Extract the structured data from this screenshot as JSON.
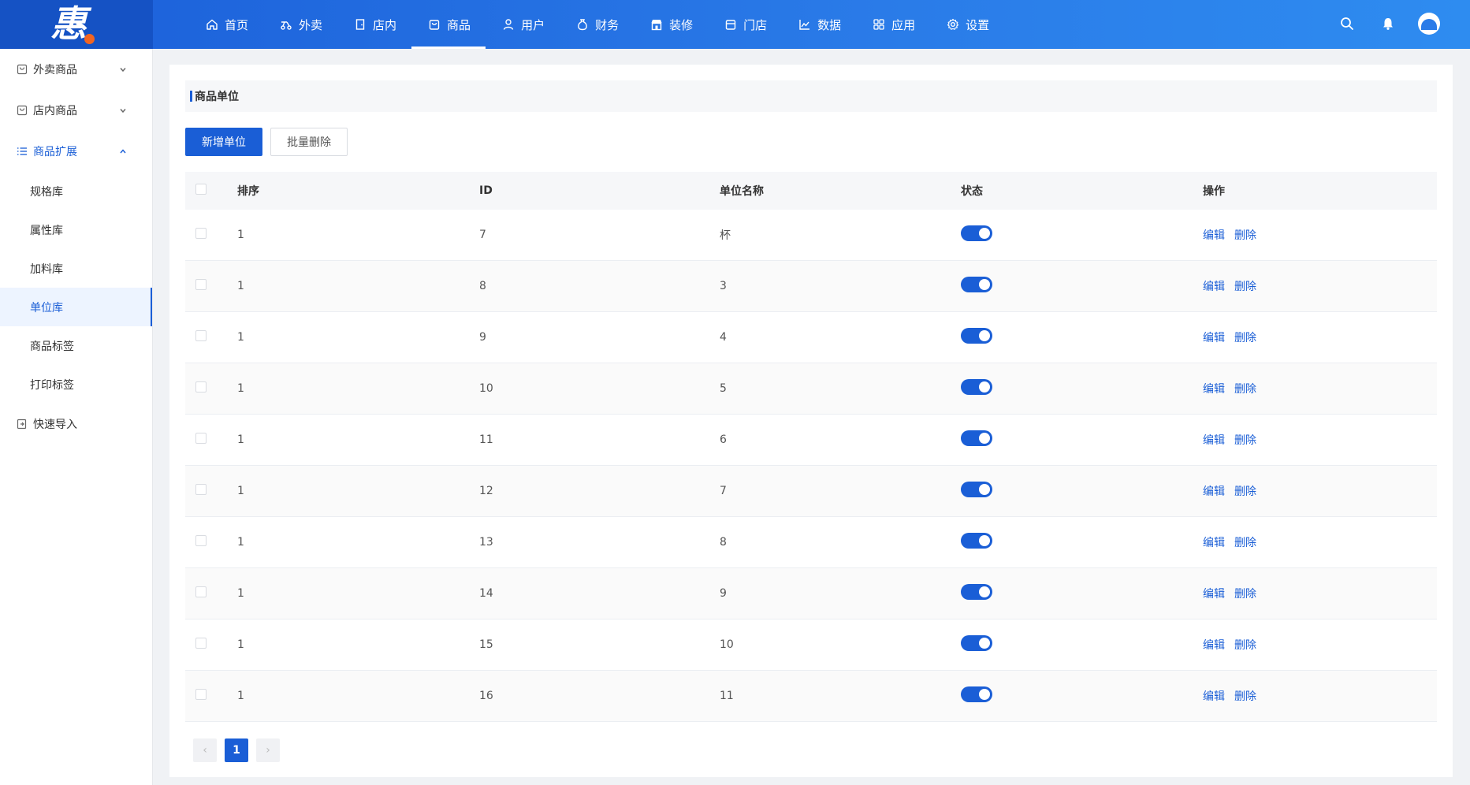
{
  "logo": {
    "glyph": "惠"
  },
  "nav": [
    {
      "label": "首页",
      "icon": "home-icon"
    },
    {
      "label": "外卖",
      "icon": "scooter-icon"
    },
    {
      "label": "店内",
      "icon": "door-icon"
    },
    {
      "label": "商品",
      "icon": "bag-icon",
      "active": true
    },
    {
      "label": "用户",
      "icon": "user-icon"
    },
    {
      "label": "财务",
      "icon": "money-bag-icon"
    },
    {
      "label": "装修",
      "icon": "storefront-icon"
    },
    {
      "label": "门店",
      "icon": "shop-icon"
    },
    {
      "label": "数据",
      "icon": "chart-line-icon"
    },
    {
      "label": "应用",
      "icon": "apps-icon"
    },
    {
      "label": "设置",
      "icon": "gear-icon"
    }
  ],
  "sidebar": {
    "groups": [
      {
        "label": "外卖商品",
        "icon": "bag-icon",
        "open": false
      },
      {
        "label": "店内商品",
        "icon": "bag-icon",
        "open": false
      },
      {
        "label": "商品扩展",
        "icon": "list-icon",
        "open": true,
        "items": [
          {
            "label": "规格库"
          },
          {
            "label": "属性库"
          },
          {
            "label": "加料库"
          },
          {
            "label": "单位库",
            "active": true
          },
          {
            "label": "商品标签"
          },
          {
            "label": "打印标签"
          }
        ]
      }
    ],
    "extra": {
      "label": "快速导入",
      "icon": "import-icon"
    }
  },
  "main": {
    "title": "商品单位",
    "add_button": "新增单位",
    "batch_delete_button": "批量删除",
    "table": {
      "headers": {
        "sort": "排序",
        "id": "ID",
        "name": "单位名称",
        "status": "状态",
        "op": "操作"
      },
      "rows": [
        {
          "sort": "1",
          "id": "7",
          "name": "杯",
          "status": true
        },
        {
          "sort": "1",
          "id": "8",
          "name": "3",
          "status": true
        },
        {
          "sort": "1",
          "id": "9",
          "name": "4",
          "status": true
        },
        {
          "sort": "1",
          "id": "10",
          "name": "5",
          "status": true
        },
        {
          "sort": "1",
          "id": "11",
          "name": "6",
          "status": true
        },
        {
          "sort": "1",
          "id": "12",
          "name": "7",
          "status": true
        },
        {
          "sort": "1",
          "id": "13",
          "name": "8",
          "status": true
        },
        {
          "sort": "1",
          "id": "14",
          "name": "9",
          "status": true
        },
        {
          "sort": "1",
          "id": "15",
          "name": "10",
          "status": true
        },
        {
          "sort": "1",
          "id": "16",
          "name": "11",
          "status": true
        }
      ],
      "edit_label": "编辑",
      "delete_label": "删除"
    },
    "pagination": {
      "current": "1",
      "prev": "‹",
      "next": "›"
    }
  },
  "colors": {
    "primary": "#1a5ed6",
    "topbar": "#2a7be8",
    "logo_bg": "#1552c4",
    "logo_dot": "#f26522"
  }
}
